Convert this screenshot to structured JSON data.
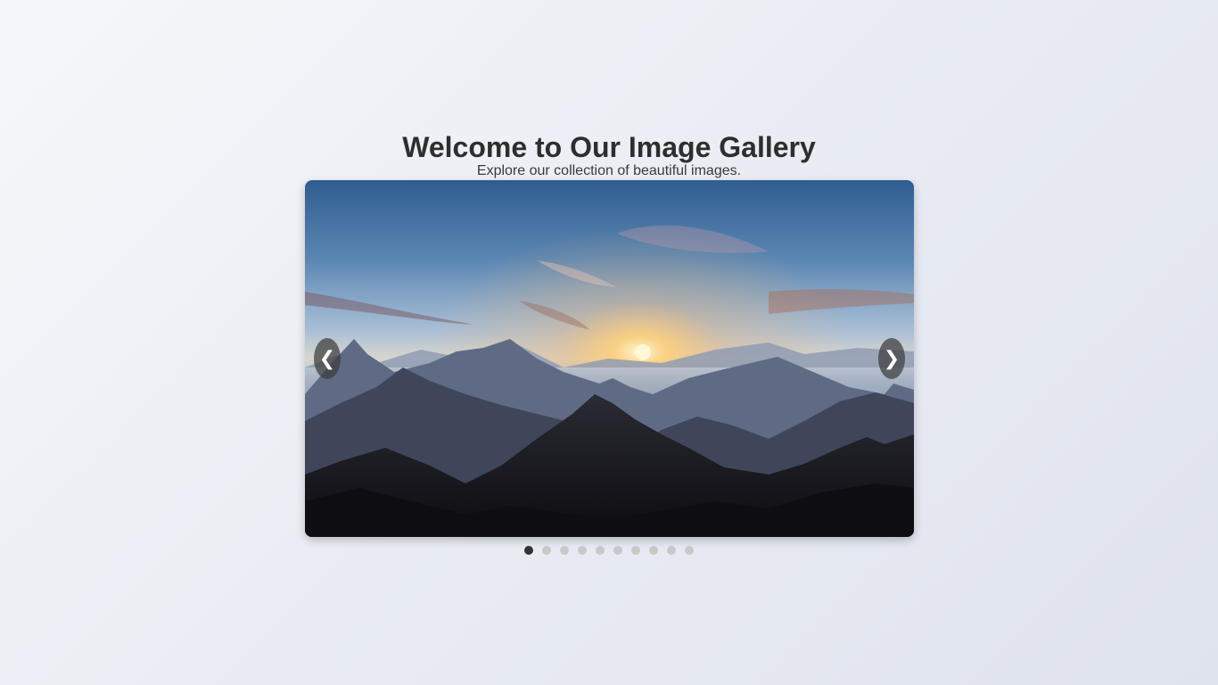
{
  "header": {
    "title": "Welcome to Our Image Gallery",
    "subtitle": "Explore our collection of beautiful images."
  },
  "slider": {
    "prev_label": "❮",
    "next_label": "❯",
    "current_index": 0,
    "total_slides": 10,
    "image_subject": "mountain range at sunrise",
    "dot_colors": {
      "active": "#333333",
      "inactive": "#c8c8c8"
    }
  }
}
